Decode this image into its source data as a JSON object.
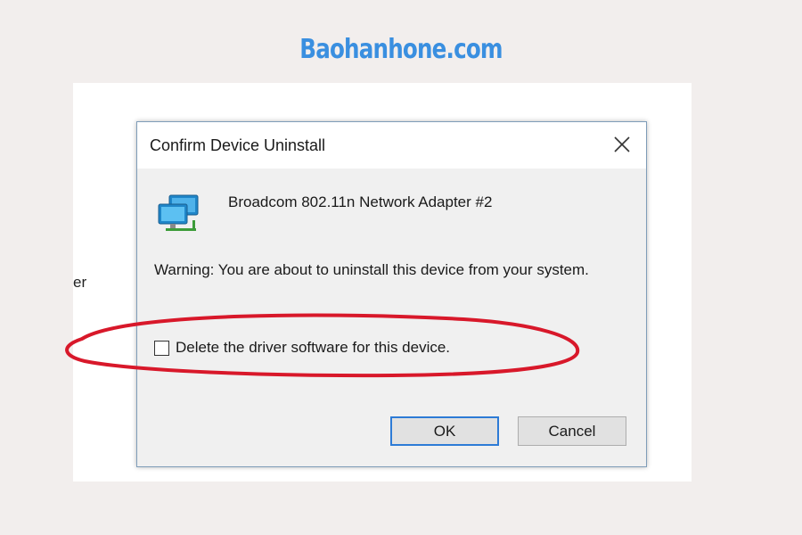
{
  "site": {
    "brand": "Baohanhone.com",
    "brand_color": "#3a8fe0"
  },
  "background": {
    "fragment_text": "er"
  },
  "dialog": {
    "title": "Confirm Device Uninstall",
    "close_icon": "close-icon",
    "device_icon": "network-adapter-icon",
    "device_name": "Broadcom 802.11n Network Adapter #2",
    "warning": "Warning: You are about to uninstall this device from your system.",
    "checkbox": {
      "label": "Delete the driver software for this device.",
      "checked": false
    },
    "buttons": {
      "ok_label": "OK",
      "cancel_label": "Cancel"
    }
  },
  "annotation": {
    "type": "highlight-ellipse",
    "color": "#d8182a",
    "target": "delete-driver-checkbox"
  }
}
